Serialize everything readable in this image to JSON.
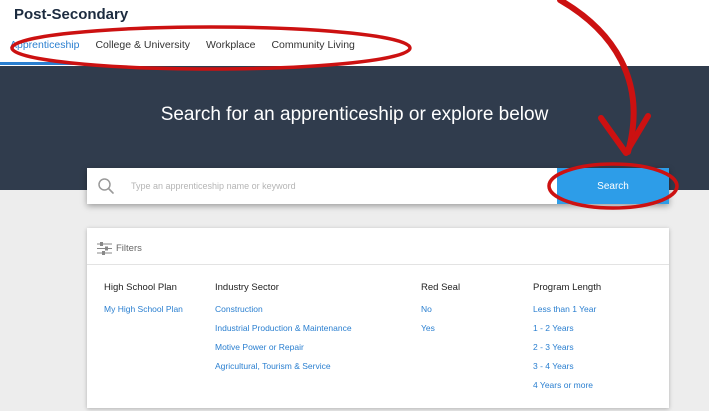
{
  "header": {
    "section_title": "Post-Secondary",
    "tabs": [
      {
        "label": "Apprenticeship",
        "active": true
      },
      {
        "label": "College & University",
        "active": false
      },
      {
        "label": "Workplace",
        "active": false
      },
      {
        "label": "Community Living",
        "active": false
      }
    ]
  },
  "hero": {
    "title": "Search for an apprenticeship or explore below"
  },
  "search": {
    "placeholder": "Type an apprenticeship name or keyword",
    "value": "",
    "button_label": "Search",
    "icon": "search-icon"
  },
  "filters": {
    "title": "Filters",
    "icon": "sliders-icon",
    "columns": [
      {
        "header": "High School Plan",
        "items": [
          "My High School Plan"
        ]
      },
      {
        "header": "Industry Sector",
        "items": [
          "Construction",
          "Industrial Production & Maintenance",
          "Motive Power or Repair",
          "Agricultural, Tourism & Service"
        ]
      },
      {
        "header": "Red Seal",
        "items": [
          "No",
          "Yes"
        ]
      },
      {
        "header": "Program Length",
        "items": [
          "Less than 1 Year",
          "1 - 2 Years",
          "2 - 3 Years",
          "3 - 4 Years",
          "4 Years or more"
        ]
      }
    ]
  },
  "colors": {
    "hero_bg": "#303c4d",
    "accent": "#2a7fd0",
    "button": "#2d9de8",
    "annotation": "#cc1111"
  }
}
